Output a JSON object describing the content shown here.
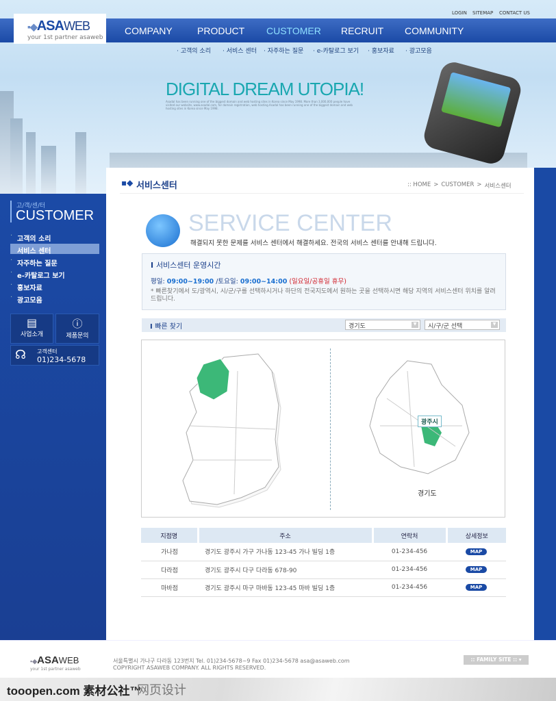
{
  "header": {
    "logo": "ASA",
    "logo_suffix": "WEB",
    "tagline": "your 1st partner asaweb",
    "util": [
      "LOGIN",
      "SITEMAP",
      "CONTACT US"
    ],
    "nav": [
      "COMPANY",
      "PRODUCT",
      "CUSTOMER",
      "RECRUIT",
      "COMMUNITY"
    ],
    "subnav": [
      "· 고객의 소리",
      "· 서비스 센터",
      "· 자주하는 질문",
      "· e-카탈로그 보기",
      "· 홍보자료",
      "· 광고모음"
    ]
  },
  "banner": {
    "headline": "DIGITAL DREAM UTOPIA!",
    "sub": "Asadal has been running one of the biggest domain and web hosting sites in Korea since May 1998. More than 3,000,000 people have visited our website, www.asadal.com, for domain registration, web hosting.Asadal has been running one of the biggest domain and web hosting sites in Korea since May 1998."
  },
  "sidebar": {
    "kicker": "고/객/센/터",
    "title": "CUSTOMER",
    "items": [
      "고객의 소리",
      "서비스 센터",
      "자주하는 질문",
      "e-카탈로그 보기",
      "홍보자료",
      "광고모음"
    ],
    "btn_business": "사업소개",
    "btn_inquiry": "제품문의",
    "cs_label": "고객센터",
    "cs_phone": "01)234-5678"
  },
  "page": {
    "title": "서비스센터",
    "breadcrumb": [
      ":: HOME",
      ">",
      "CUSTOMER",
      ">",
      "서비스센터"
    ],
    "hero_title": "SERVICE CENTER",
    "hero_desc": "해결되지 못한 문제를 서비스 센터에서 해결하세요. 전국의 서비스 센터를 안내해 드립니다.",
    "hours_title": "서비스센터 운영시간",
    "weekday_label": "평일:",
    "weekday_hours": "09:00~19:00",
    "sat_label": "/토요일:",
    "sat_hours": "09:00~14:00",
    "closed": "(일요일/공휴일 휴무)",
    "hours_note": "* 빠른찾기에서 도/광역시, 시/군/구를 선택하시거나 하단의 전국지도에서 원하는 곳을 선택하시면 해당 지역의 서비스센터 위치를 알려드립니다.",
    "quick_title": "빠른 찾기",
    "select_province": "경기도",
    "select_city": "시/구/군 선택",
    "map_city_label": "광주시",
    "map_province_label": "경기도",
    "table": {
      "headers": [
        "지점명",
        "주소",
        "연락처",
        "상세정보"
      ],
      "rows": [
        [
          "가나점",
          "경기도 광주시 가구 가나동 123-45  가나 빌딩 1층",
          "01-234-456",
          "MAP"
        ],
        [
          "다라점",
          "경기도 광주시 다구 다라동 678-90",
          "01-234-456",
          "MAP"
        ],
        [
          "마바점",
          "경기도 광주시 마구 마바동 123-45  마바 빌딩 1층",
          "01-234-456",
          "MAP"
        ]
      ]
    }
  },
  "footer": {
    "logo": "ASA",
    "logo_suffix": "WEB",
    "tagline": "your 1st partner asaweb",
    "address": "서울특별시 가나구 다라동 123번지  Tel. 01)234-5678~9  Fax 01)234-5678  asa@asaweb.com",
    "copyright": "COPYRIGHT ASAWEB COMPANY. ALL RIGHTS RESERVED.",
    "family_site": ":: FAMILY SITE ::  ▾"
  },
  "watermark": {
    "brand": "tooopen.com 素材公社™",
    "text": "网页设计"
  },
  "colors": {
    "brand": "#1a4aa5",
    "highlight": "#3cb878",
    "closed": "#d0202a"
  }
}
